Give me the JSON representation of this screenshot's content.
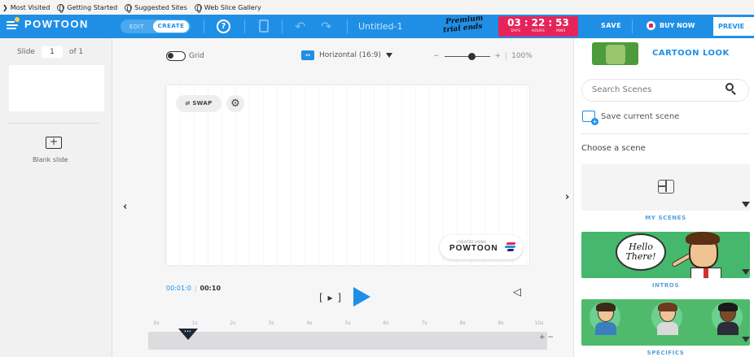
{
  "bookmarks": [
    {
      "label": "Most Visited",
      "icon": "folder-icon"
    },
    {
      "label": "Getting Started",
      "icon": "globe-icon"
    },
    {
      "label": "Suggested Sites",
      "icon": "globe-icon"
    },
    {
      "label": "Web Slice Gallery",
      "icon": "globe-icon"
    }
  ],
  "toolbar": {
    "brand": "POWTOON",
    "mode_edit": "EDIT",
    "mode_create": "CREATE",
    "help_symbol": "?",
    "document_title": "Untitled-1",
    "trial_text_line1": "Premium",
    "trial_text_line2": "trial ends",
    "timer": {
      "days": "03",
      "hours": "22",
      "mins": "53",
      "days_label": "DAYS",
      "hours_label": "HOURS",
      "mins_label": "MINS"
    },
    "save_label": "SAVE",
    "buy_label": "BUY NOW",
    "preview_label": "PREVIE",
    "colors": {
      "bar": "#1f8fe6",
      "timer": "#e6245a",
      "logo_dot": "#ffd23a"
    }
  },
  "slides_panel": {
    "slide_label": "Slide",
    "current_slide": "1",
    "total_label": "of 1",
    "blank_symbol": "+",
    "blank_label": "Blank slide"
  },
  "canvas": {
    "grid_label": "Grid",
    "aspect_icon": "↔",
    "aspect_label": "Horizontal (16:9)",
    "zoom_minus": "−",
    "zoom_plus": "+",
    "zoom_value": "100%",
    "zoom_level": 0.6,
    "swap_label": "⇄ SWAP",
    "settings_symbol": "⚙",
    "watermark_small": "CREATED USING",
    "watermark_brand": "POWTOON",
    "collapse_left": "‹",
    "collapse_right": "›"
  },
  "playback": {
    "current_time": "00:01:0",
    "separator": "|",
    "total_time": "00:10",
    "frame_play": "[ ▸ ]",
    "volume_symbol": "◁",
    "ruler_ticks": [
      "0s",
      "1s",
      "2s",
      "3s",
      "4s",
      "5s",
      "6s",
      "7s",
      "8s",
      "9s",
      "10s"
    ],
    "playhead_dots": "•••",
    "add_track_symbols": "+ −"
  },
  "scenes_panel": {
    "look_label": "CARTOON LOOK",
    "search_placeholder": "Search Scenes",
    "save_scene_label": "Save current scene",
    "choose_label": "Choose a scene",
    "categories": [
      {
        "label": "MY SCENES"
      },
      {
        "label": "INTROS",
        "bubble_line1": "Hello",
        "bubble_line2": "There!"
      },
      {
        "label": "SPECIFICS"
      }
    ]
  }
}
